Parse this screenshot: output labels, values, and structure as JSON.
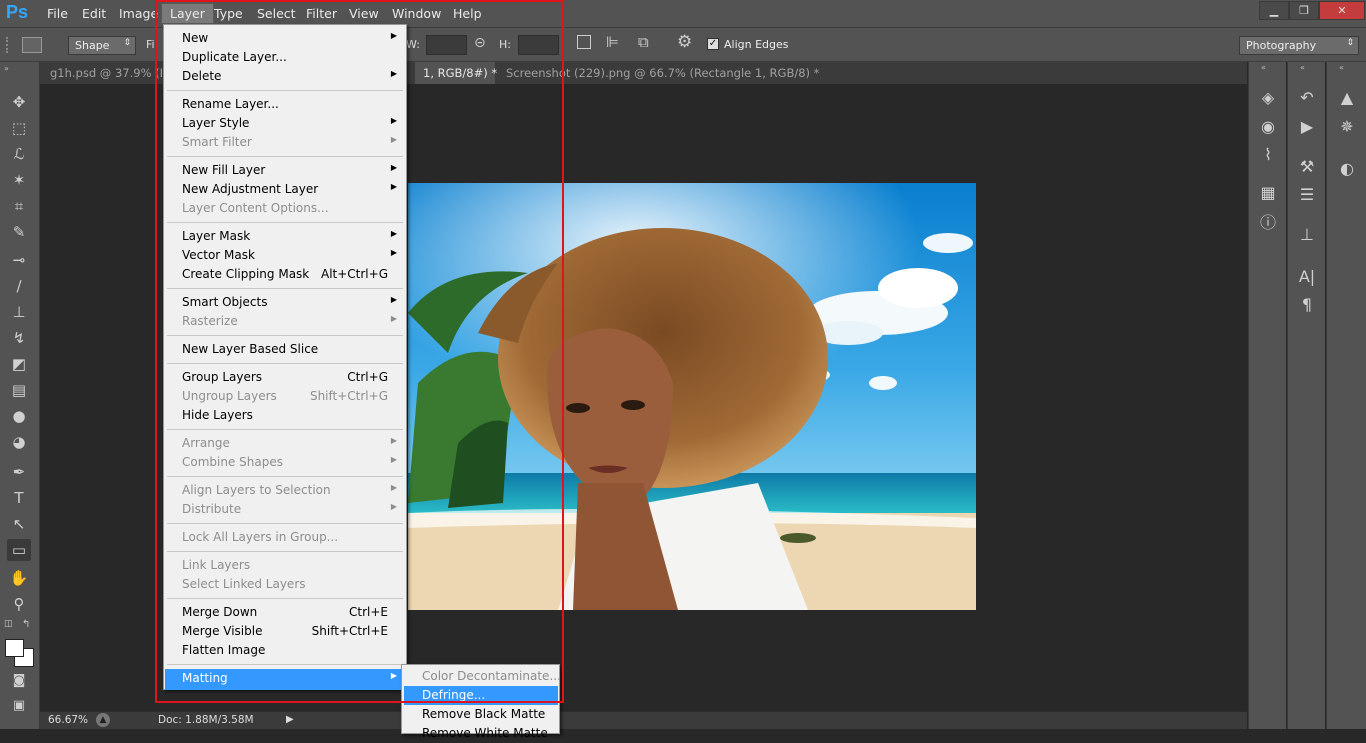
{
  "app": {
    "logo": "Ps"
  },
  "menubar": {
    "items": [
      "File",
      "Edit",
      "Image",
      "Layer",
      "Type",
      "Select",
      "Filter",
      "View",
      "Window",
      "Help"
    ],
    "active": "Layer"
  },
  "window_controls": {
    "minimize": "▁",
    "restore": "❐",
    "close": "✕"
  },
  "options": {
    "shape_mode": "Shape",
    "fill_label": "Fi",
    "width_label": "W:",
    "height_label": "H:",
    "align_edges_label": "Align Edges",
    "align_edges_checked": true,
    "workspace": "Photography"
  },
  "tabs": [
    {
      "label": "g1h.psd @ 37.9% (Lay",
      "active": false
    },
    {
      "label": "1, RGB/8#) *",
      "active": true
    },
    {
      "label": "Screenshot (229).png @ 66.7% (Rectangle 1, RGB/8) *",
      "active": false
    }
  ],
  "status": {
    "zoom": "66.67%",
    "doc": "Doc: 1.88M/3.58M"
  },
  "layer_menu": {
    "groups": [
      [
        {
          "label": "New",
          "shortcut": "",
          "submenu": true,
          "disabled": false
        },
        {
          "label": "Duplicate Layer...",
          "shortcut": "",
          "submenu": false,
          "disabled": false
        },
        {
          "label": "Delete",
          "shortcut": "",
          "submenu": true,
          "disabled": false
        }
      ],
      [
        {
          "label": "Rename Layer...",
          "shortcut": "",
          "submenu": false,
          "disabled": false
        },
        {
          "label": "Layer Style",
          "shortcut": "",
          "submenu": true,
          "disabled": false
        },
        {
          "label": "Smart Filter",
          "shortcut": "",
          "submenu": true,
          "disabled": true
        }
      ],
      [
        {
          "label": "New Fill Layer",
          "shortcut": "",
          "submenu": true,
          "disabled": false
        },
        {
          "label": "New Adjustment Layer",
          "shortcut": "",
          "submenu": true,
          "disabled": false
        },
        {
          "label": "Layer Content Options...",
          "shortcut": "",
          "submenu": false,
          "disabled": true
        }
      ],
      [
        {
          "label": "Layer Mask",
          "shortcut": "",
          "submenu": true,
          "disabled": false
        },
        {
          "label": "Vector Mask",
          "shortcut": "",
          "submenu": true,
          "disabled": false
        },
        {
          "label": "Create Clipping Mask",
          "shortcut": "Alt+Ctrl+G",
          "submenu": false,
          "disabled": false
        }
      ],
      [
        {
          "label": "Smart Objects",
          "shortcut": "",
          "submenu": true,
          "disabled": false
        },
        {
          "label": "Rasterize",
          "shortcut": "",
          "submenu": true,
          "disabled": true
        }
      ],
      [
        {
          "label": "New Layer Based Slice",
          "shortcut": "",
          "submenu": false,
          "disabled": false
        }
      ],
      [
        {
          "label": "Group Layers",
          "shortcut": "Ctrl+G",
          "submenu": false,
          "disabled": false
        },
        {
          "label": "Ungroup Layers",
          "shortcut": "Shift+Ctrl+G",
          "submenu": false,
          "disabled": true
        },
        {
          "label": "Hide Layers",
          "shortcut": "",
          "submenu": false,
          "disabled": false
        }
      ],
      [
        {
          "label": "Arrange",
          "shortcut": "",
          "submenu": true,
          "disabled": true
        },
        {
          "label": "Combine Shapes",
          "shortcut": "",
          "submenu": true,
          "disabled": true
        }
      ],
      [
        {
          "label": "Align Layers to Selection",
          "shortcut": "",
          "submenu": true,
          "disabled": true
        },
        {
          "label": "Distribute",
          "shortcut": "",
          "submenu": true,
          "disabled": true
        }
      ],
      [
        {
          "label": "Lock All Layers in Group...",
          "shortcut": "",
          "submenu": false,
          "disabled": true
        }
      ],
      [
        {
          "label": "Link Layers",
          "shortcut": "",
          "submenu": false,
          "disabled": true
        },
        {
          "label": "Select Linked Layers",
          "shortcut": "",
          "submenu": false,
          "disabled": true
        }
      ],
      [
        {
          "label": "Merge Down",
          "shortcut": "Ctrl+E",
          "submenu": false,
          "disabled": false
        },
        {
          "label": "Merge Visible",
          "shortcut": "Shift+Ctrl+E",
          "submenu": false,
          "disabled": false
        },
        {
          "label": "Flatten Image",
          "shortcut": "",
          "submenu": false,
          "disabled": false
        }
      ],
      [
        {
          "label": "Matting",
          "shortcut": "",
          "submenu": true,
          "disabled": false,
          "highlighted": true
        }
      ]
    ]
  },
  "matting_submenu": [
    {
      "label": "Color Decontaminate...",
      "disabled": true,
      "highlighted": false
    },
    {
      "label": "Defringe...",
      "disabled": false,
      "highlighted": true
    },
    {
      "label": "Remove Black Matte",
      "disabled": false,
      "highlighted": false
    },
    {
      "label": "Remove White Matte",
      "disabled": false,
      "highlighted": false
    }
  ],
  "colors": {
    "accent": "#3399ff",
    "annotation": "#e0141e",
    "ui": "#535353"
  }
}
